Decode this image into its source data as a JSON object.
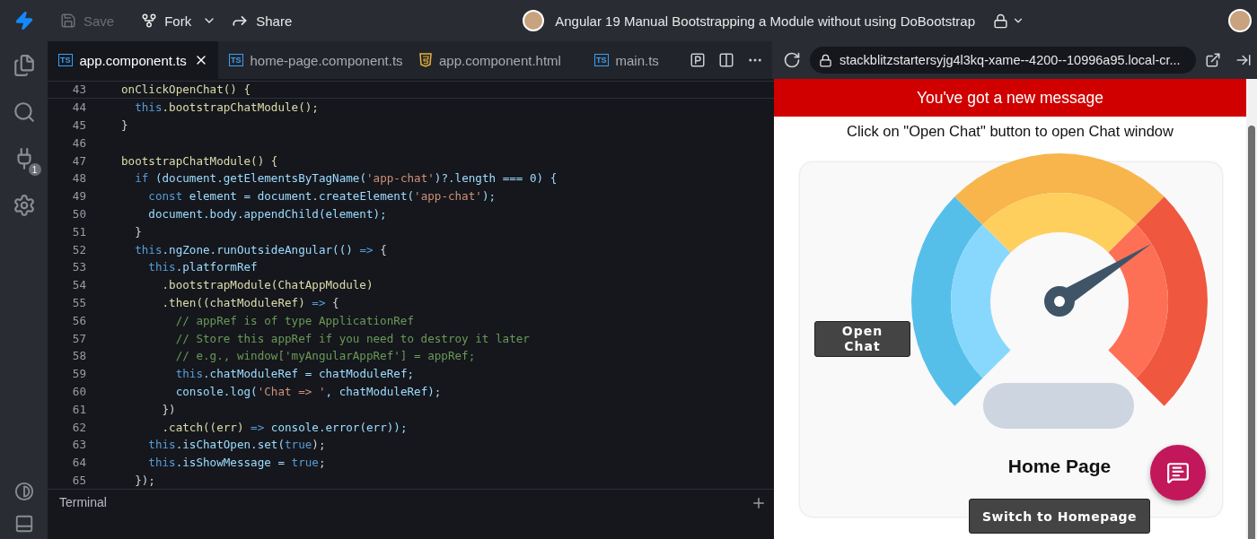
{
  "topbar": {
    "save": {
      "label": "Save",
      "disabled": true
    },
    "fork": {
      "label": "Fork"
    },
    "share": {
      "label": "Share"
    },
    "title": "Angular 19 Manual Bootstrapping a Module without using DoBootstrap"
  },
  "activity_bar": {
    "extensions_badge": "1"
  },
  "tabs": [
    {
      "label": "app.component.ts",
      "kind": "ts",
      "badge": "TS",
      "selected": true
    },
    {
      "label": "home-page.component.ts",
      "kind": "ts",
      "badge": "TS",
      "selected": false
    },
    {
      "label": "app.component.html",
      "kind": "html",
      "selected": false
    },
    {
      "label": "main.ts",
      "kind": "ts",
      "badge": "TS",
      "selected": false
    }
  ],
  "editor": {
    "lines": [
      {
        "number": "43",
        "tokens": [
          {
            "kind": "fn",
            "text": "onClickOpenChat() {"
          }
        ]
      },
      {
        "number": "44",
        "tokens": [
          {
            "kind": "keyword",
            "text": "  this"
          },
          {
            "kind": "fn",
            "text": ".bootstrapChatModule();"
          }
        ]
      },
      {
        "number": "45",
        "tokens": [
          {
            "kind": "plain",
            "text": "}"
          }
        ]
      },
      {
        "number": "46"
      },
      {
        "number": "47",
        "tokens": [
          {
            "kind": "fn",
            "text": "bootstrapChatModule() {"
          }
        ]
      },
      {
        "number": "48",
        "tokens": [
          {
            "kind": "keyword",
            "text": "  if"
          },
          {
            "kind": "var",
            "text": " (document.getElementsByTagName("
          },
          {
            "kind": "string",
            "text": "'app-chat'"
          },
          {
            "kind": "var",
            "text": ")?.length === 0) {"
          }
        ]
      },
      {
        "number": "49",
        "tokens": [
          {
            "kind": "keyword",
            "text": "    const"
          },
          {
            "kind": "var",
            "text": " element = document.createElement("
          },
          {
            "kind": "string",
            "text": "'app-chat'"
          },
          {
            "kind": "var",
            "text": ");"
          }
        ]
      },
      {
        "number": "50",
        "tokens": [
          {
            "kind": "var",
            "text": "    document.body.appendChild(element);"
          }
        ]
      },
      {
        "number": "51",
        "tokens": [
          {
            "kind": "plain",
            "text": "  }"
          }
        ]
      },
      {
        "number": "52",
        "tokens": [
          {
            "kind": "keyword",
            "text": "  this"
          },
          {
            "kind": "var",
            "text": ".ngZone.runOutsideAngular(() "
          },
          {
            "kind": "keyword",
            "text": "=>"
          },
          {
            "kind": "plain",
            "text": " {"
          }
        ]
      },
      {
        "number": "53",
        "tokens": [
          {
            "kind": "keyword",
            "text": "    this"
          },
          {
            "kind": "var",
            "text": ".platformRef"
          }
        ]
      },
      {
        "number": "54",
        "tokens": [
          {
            "kind": "fn",
            "text": "      .bootstrapModule(ChatAppModule)"
          }
        ]
      },
      {
        "number": "55",
        "tokens": [
          {
            "kind": "fn",
            "text": "      .then((chatModuleRef) "
          },
          {
            "kind": "keyword",
            "text": "=>"
          },
          {
            "kind": "plain",
            "text": " {"
          }
        ]
      },
      {
        "number": "56",
        "tokens": [
          {
            "kind": "comment",
            "text": "        // appRef is of type ApplicationRef"
          }
        ]
      },
      {
        "number": "57",
        "tokens": [
          {
            "kind": "comment",
            "text": "        // Store this appRef if you need to destroy it later"
          }
        ]
      },
      {
        "number": "58",
        "tokens": [
          {
            "kind": "comment",
            "text": "        // e.g., window['myAngularAppRef'] = appRef;"
          }
        ]
      },
      {
        "number": "59",
        "tokens": [
          {
            "kind": "keyword",
            "text": "        this"
          },
          {
            "kind": "var",
            "text": ".chatModuleRef = chatModuleRef;"
          }
        ]
      },
      {
        "number": "60",
        "tokens": [
          {
            "kind": "var",
            "text": "        console.log("
          },
          {
            "kind": "string",
            "text": "'Chat => '"
          },
          {
            "kind": "var",
            "text": ", chatModuleRef);"
          }
        ]
      },
      {
        "number": "61",
        "tokens": [
          {
            "kind": "plain",
            "text": "      })"
          }
        ]
      },
      {
        "number": "62",
        "tokens": [
          {
            "kind": "fn",
            "text": "      .catch((err) "
          },
          {
            "kind": "keyword",
            "text": "=>"
          },
          {
            "kind": "var",
            "text": " console.error(err));"
          }
        ]
      },
      {
        "number": "63",
        "tokens": [
          {
            "kind": "keyword",
            "text": "    this"
          },
          {
            "kind": "var",
            "text": ".isChatOpen.set("
          },
          {
            "kind": "keyword",
            "text": "true"
          },
          {
            "kind": "plain",
            "text": ");"
          }
        ]
      },
      {
        "number": "64",
        "tokens": [
          {
            "kind": "keyword",
            "text": "    this"
          },
          {
            "kind": "var",
            "text": ".isShowMessage = "
          },
          {
            "kind": "keyword",
            "text": "true"
          },
          {
            "kind": "plain",
            "text": ";"
          }
        ]
      },
      {
        "number": "65",
        "tokens": [
          {
            "kind": "plain",
            "text": "  });"
          }
        ]
      }
    ]
  },
  "terminal": {
    "title": "Terminal"
  },
  "preview": {
    "url": "stackblitzstartersyjg4l3kq-xame--4200--10996a95.local-cr...",
    "banner": "You've got a new message",
    "instruction": "Click on \"Open Chat\" button to open Chat window",
    "open_chat_button": "Open Chat",
    "page_title": "Home Page",
    "switch_button": "Switch to Homepage"
  }
}
